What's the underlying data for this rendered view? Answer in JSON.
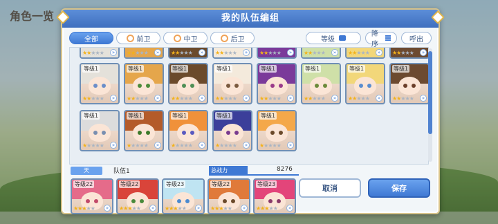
{
  "background": {
    "title": "角色一览"
  },
  "modal": {
    "title": "我的队伍编组"
  },
  "filters": [
    {
      "label": "全部",
      "active": true
    },
    {
      "label": "前卫",
      "active": false
    },
    {
      "label": "中卫",
      "active": false
    },
    {
      "label": "后卫",
      "active": false
    }
  ],
  "controls": {
    "sort_label": "等级",
    "order_label": "降序",
    "exit_label": "呼出"
  },
  "grid": {
    "rows": [
      [
        {
          "level": "等级1",
          "stars": 2,
          "hair": "#e4e1da",
          "eyes": "#6b8ec9"
        },
        {
          "level": "等级1",
          "stars": 2,
          "hair": "#e5a64b",
          "eyes": "#4c8c3b"
        },
        {
          "level": "等级1",
          "stars": 2,
          "hair": "#6b4a2b",
          "eyes": "#4f8f56"
        },
        {
          "level": "等级1",
          "stars": 2,
          "hair": "#f4eadc",
          "eyes": "#7b5a3f"
        },
        {
          "level": "等级1",
          "stars": 2,
          "hair": "#7b3a9a",
          "eyes": "#9b3b8a"
        },
        {
          "level": "等级1",
          "stars": 2,
          "hair": "#cfe0a8",
          "eyes": "#6c8a3a"
        },
        {
          "level": "等级1",
          "stars": 2,
          "hair": "#f2d77a",
          "eyes": "#5a8ed0"
        },
        {
          "level": "等级1",
          "stars": 2,
          "hair": "#6c4a30",
          "eyes": "#6b3f2a"
        }
      ],
      [
        {
          "level": "等级1",
          "stars": 1,
          "hair": "#dcdcdc",
          "eyes": "#7a8fb0"
        },
        {
          "level": "等级1",
          "stars": 1,
          "hair": "#b45b2a",
          "eyes": "#3d7a2b"
        },
        {
          "level": "等级1",
          "stars": 1,
          "hair": "#f0913a",
          "eyes": "#5a5ac0"
        },
        {
          "level": "等级1",
          "stars": 1,
          "hair": "#3b3f9a",
          "eyes": "#7a3b8f"
        },
        {
          "level": "等级1",
          "stars": 1,
          "hair": "#f4a84a",
          "eyes": "#6b4a2b"
        }
      ]
    ]
  },
  "team": {
    "tag": "天",
    "name": "队伍1",
    "power_label": "总战力",
    "power_value": "8276",
    "members": [
      {
        "level": "等级22",
        "stars": 3,
        "hair": "#e56b8a",
        "eyes": "#c24a6a"
      },
      {
        "level": "等级22",
        "stars": 3,
        "hair": "#d9443a",
        "eyes": "#4a8a3b"
      },
      {
        "level": "等级23",
        "stars": 3,
        "hair": "#bfe4f2",
        "eyes": "#4a8ad0"
      },
      {
        "level": "等级22",
        "stars": 3,
        "hair": "#e07a3a",
        "eyes": "#6b4a2b"
      },
      {
        "level": "等级23",
        "stars": 3,
        "hair": "#e3457a",
        "eyes": "#8a3a6a"
      }
    ]
  },
  "buttons": {
    "cancel": "取消",
    "save": "保存"
  },
  "colors": {
    "accent": "#3f79d4",
    "frame": "#d8c48a",
    "star": "#f3b21a"
  }
}
